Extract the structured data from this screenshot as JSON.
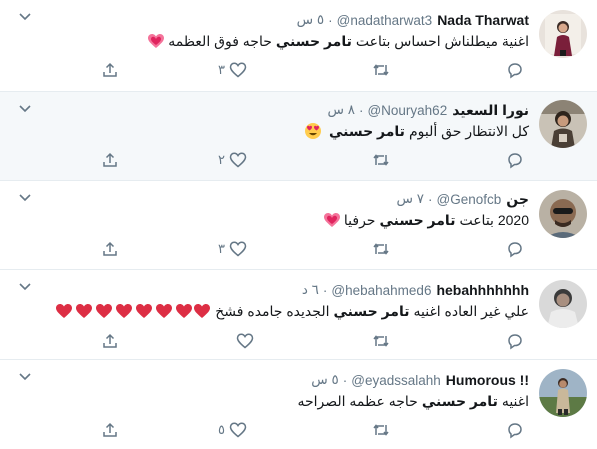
{
  "colors": {
    "highlight": "#14171a",
    "secondary": "#657786",
    "heart": "#e0245e",
    "border": "#e6ecf0"
  },
  "tweets": [
    {
      "name": "Nada Tharwat",
      "handle": "@nadatharwat3",
      "time": "٥ س",
      "text_before": "اغنية ميطلناش احساس بتاعت",
      "highlight": "تامر حسني",
      "text_after": "حاجه فوق العظمه",
      "emoji": "sparkling-heart-icon",
      "likes": "٣",
      "likes_label": "٣"
    },
    {
      "name": "نورا السعيد",
      "handle": "@Nouryah62",
      "time": "٨ س",
      "text_before": "كل الانتظار حق ألبوم",
      "highlight": "تامر حسني",
      "text_after": "",
      "emoji": "heart-eyes-icon",
      "likes": "٢"
    },
    {
      "name": "جن",
      "handle": "@Genofcb",
      "time": "٧ س",
      "text_before": "2020 بتاعت",
      "highlight": "تامر حسني",
      "text_after": "حرفيا",
      "emoji": "sparkling-heart-icon",
      "likes": "٣"
    },
    {
      "name": "hebahhhhhhh",
      "handle": "@hebahahmed6",
      "time": "٦ د",
      "text_before": "علي غير العاده اغنيه",
      "highlight": "تامر حسني",
      "text_after": "الجديده جامده فشخ",
      "emoji": "red-heart-icon",
      "likes": ""
    },
    {
      "name": "Humorous !!",
      "handle": "@eyadssalahh",
      "time": "٥ س",
      "text_before": "اغنيه",
      "highlight": "تامر حسني",
      "text_after": "حاجه عظمه الصراحه",
      "emoji": "",
      "likes": "٥"
    }
  ]
}
